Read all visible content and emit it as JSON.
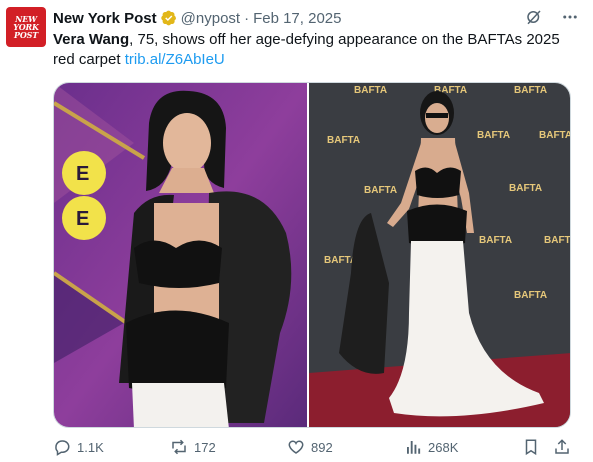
{
  "account": {
    "logo_text": [
      "NEW",
      "YORK",
      "POST"
    ],
    "name": "New York Post",
    "handle": "@nypost",
    "separator": "·",
    "date": "Feb 17, 2025"
  },
  "tweet": {
    "bold": "Vera Wang",
    "text": ", 75, shows off her age-defying appearance on the BAFTAs 2025 red carpet ",
    "link": "trib.al/Z6AbIeU"
  },
  "media": {
    "left_sign": "EE",
    "backdrop_logos": [
      "BAFTA",
      "BAFTA",
      "BAFTA",
      "BAFTA",
      "BAFTA",
      "BAFTA",
      "BAFTA",
      "BAFTA",
      "BAFTA",
      "BAFTA",
      "BAFTA",
      "BAFTA"
    ]
  },
  "stats": {
    "replies": "1.1K",
    "reposts": "172",
    "likes": "892",
    "views": "268K"
  },
  "colors": {
    "brand_red": "#d21f26",
    "link": "#1d9bf0",
    "verified_gold": "#e2b719",
    "muted": "#536471"
  }
}
